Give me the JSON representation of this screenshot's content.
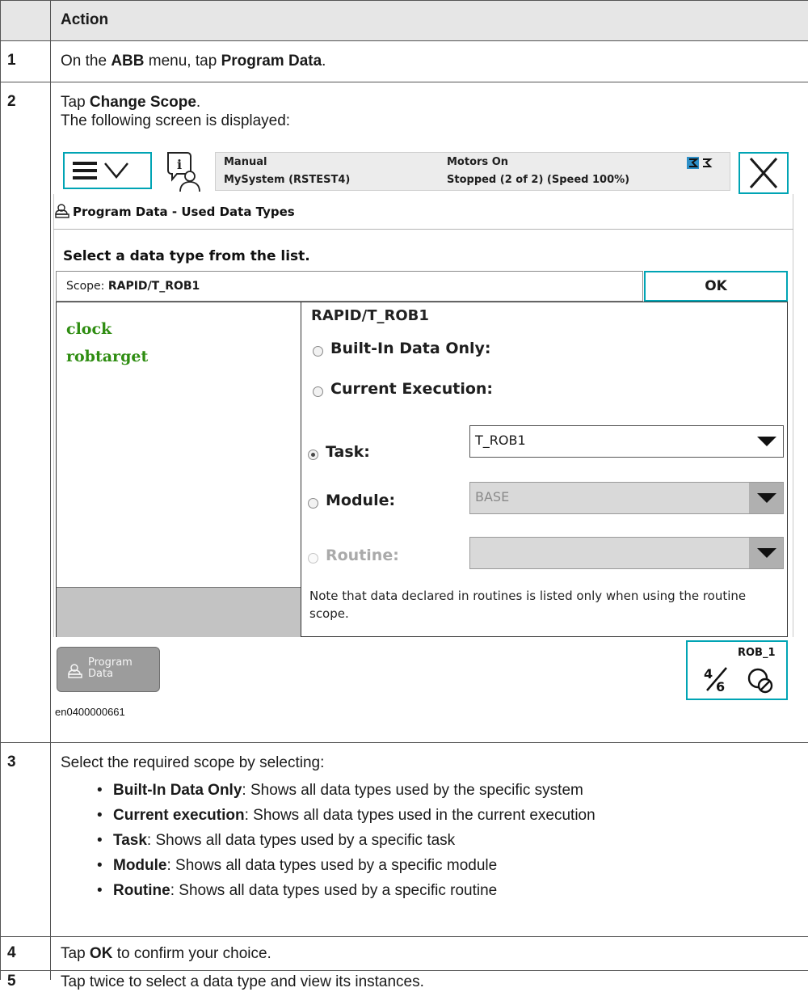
{
  "table": {
    "header": {
      "num": "",
      "action": "Action"
    },
    "rows": [
      {
        "num": "1",
        "text_pre": "On the ",
        "b1": "ABB",
        "text_mid": " menu, tap ",
        "b2": "Program Data",
        "text_post": "."
      },
      {
        "num": "2",
        "line1_pre": "Tap ",
        "line1_b": "Change Scope",
        "line1_post": ".",
        "line2": "The following screen is displayed:",
        "figure_id": "en0400000661"
      },
      {
        "num": "3",
        "intro": "Select the required scope by selecting:",
        "bullets": [
          {
            "term": "Built-In Data Only",
            "desc": ": Shows all data types used by the specific system"
          },
          {
            "term": "Current execution",
            "desc": ": Shows all data types used in the current execution"
          },
          {
            "term": "Task",
            "desc": ": Shows all data types used by a specific task"
          },
          {
            "term": "Module",
            "desc": ": Shows all data types used by a specific module"
          },
          {
            "term": "Routine",
            "desc": ": Shows all data types used by a specific routine"
          }
        ]
      },
      {
        "num": "4",
        "pre": "Tap ",
        "b": "OK",
        "post": " to confirm your choice."
      },
      {
        "num": "5",
        "text": "Tap twice to select a data type and view its instances."
      }
    ]
  },
  "pendant": {
    "status": {
      "mode": "Manual",
      "system": "MySystem (RSTEST4)",
      "motors": "Motors On",
      "state": "Stopped (2 of 2) (Speed 100%)"
    },
    "title": "Program Data - Used Data Types",
    "instruction": "Select a data type from the list.",
    "scope_prefix": "Scope: ",
    "scope_value": "RAPID/T_ROB1",
    "ok_label": "OK",
    "data_types": [
      "clock",
      "robtarget"
    ],
    "pane_title": "RAPID/T_ROB1",
    "options": {
      "builtin": "Built-In Data Only:",
      "current": "Current Execution:",
      "task": "Task:",
      "module": "Module:",
      "routine": "Routine:"
    },
    "selected_option": "task",
    "task_value": "T_ROB1",
    "module_value": "BASE",
    "routine_value": "",
    "note": "Note that data declared in routines is listed only when using the routine scope.",
    "bottom": {
      "program_data_line1": "Program",
      "program_data_line2": "Data",
      "rob_label": "ROB_1"
    },
    "accent_color": "#00a4b4",
    "datatype_color": "#2f8d12"
  }
}
